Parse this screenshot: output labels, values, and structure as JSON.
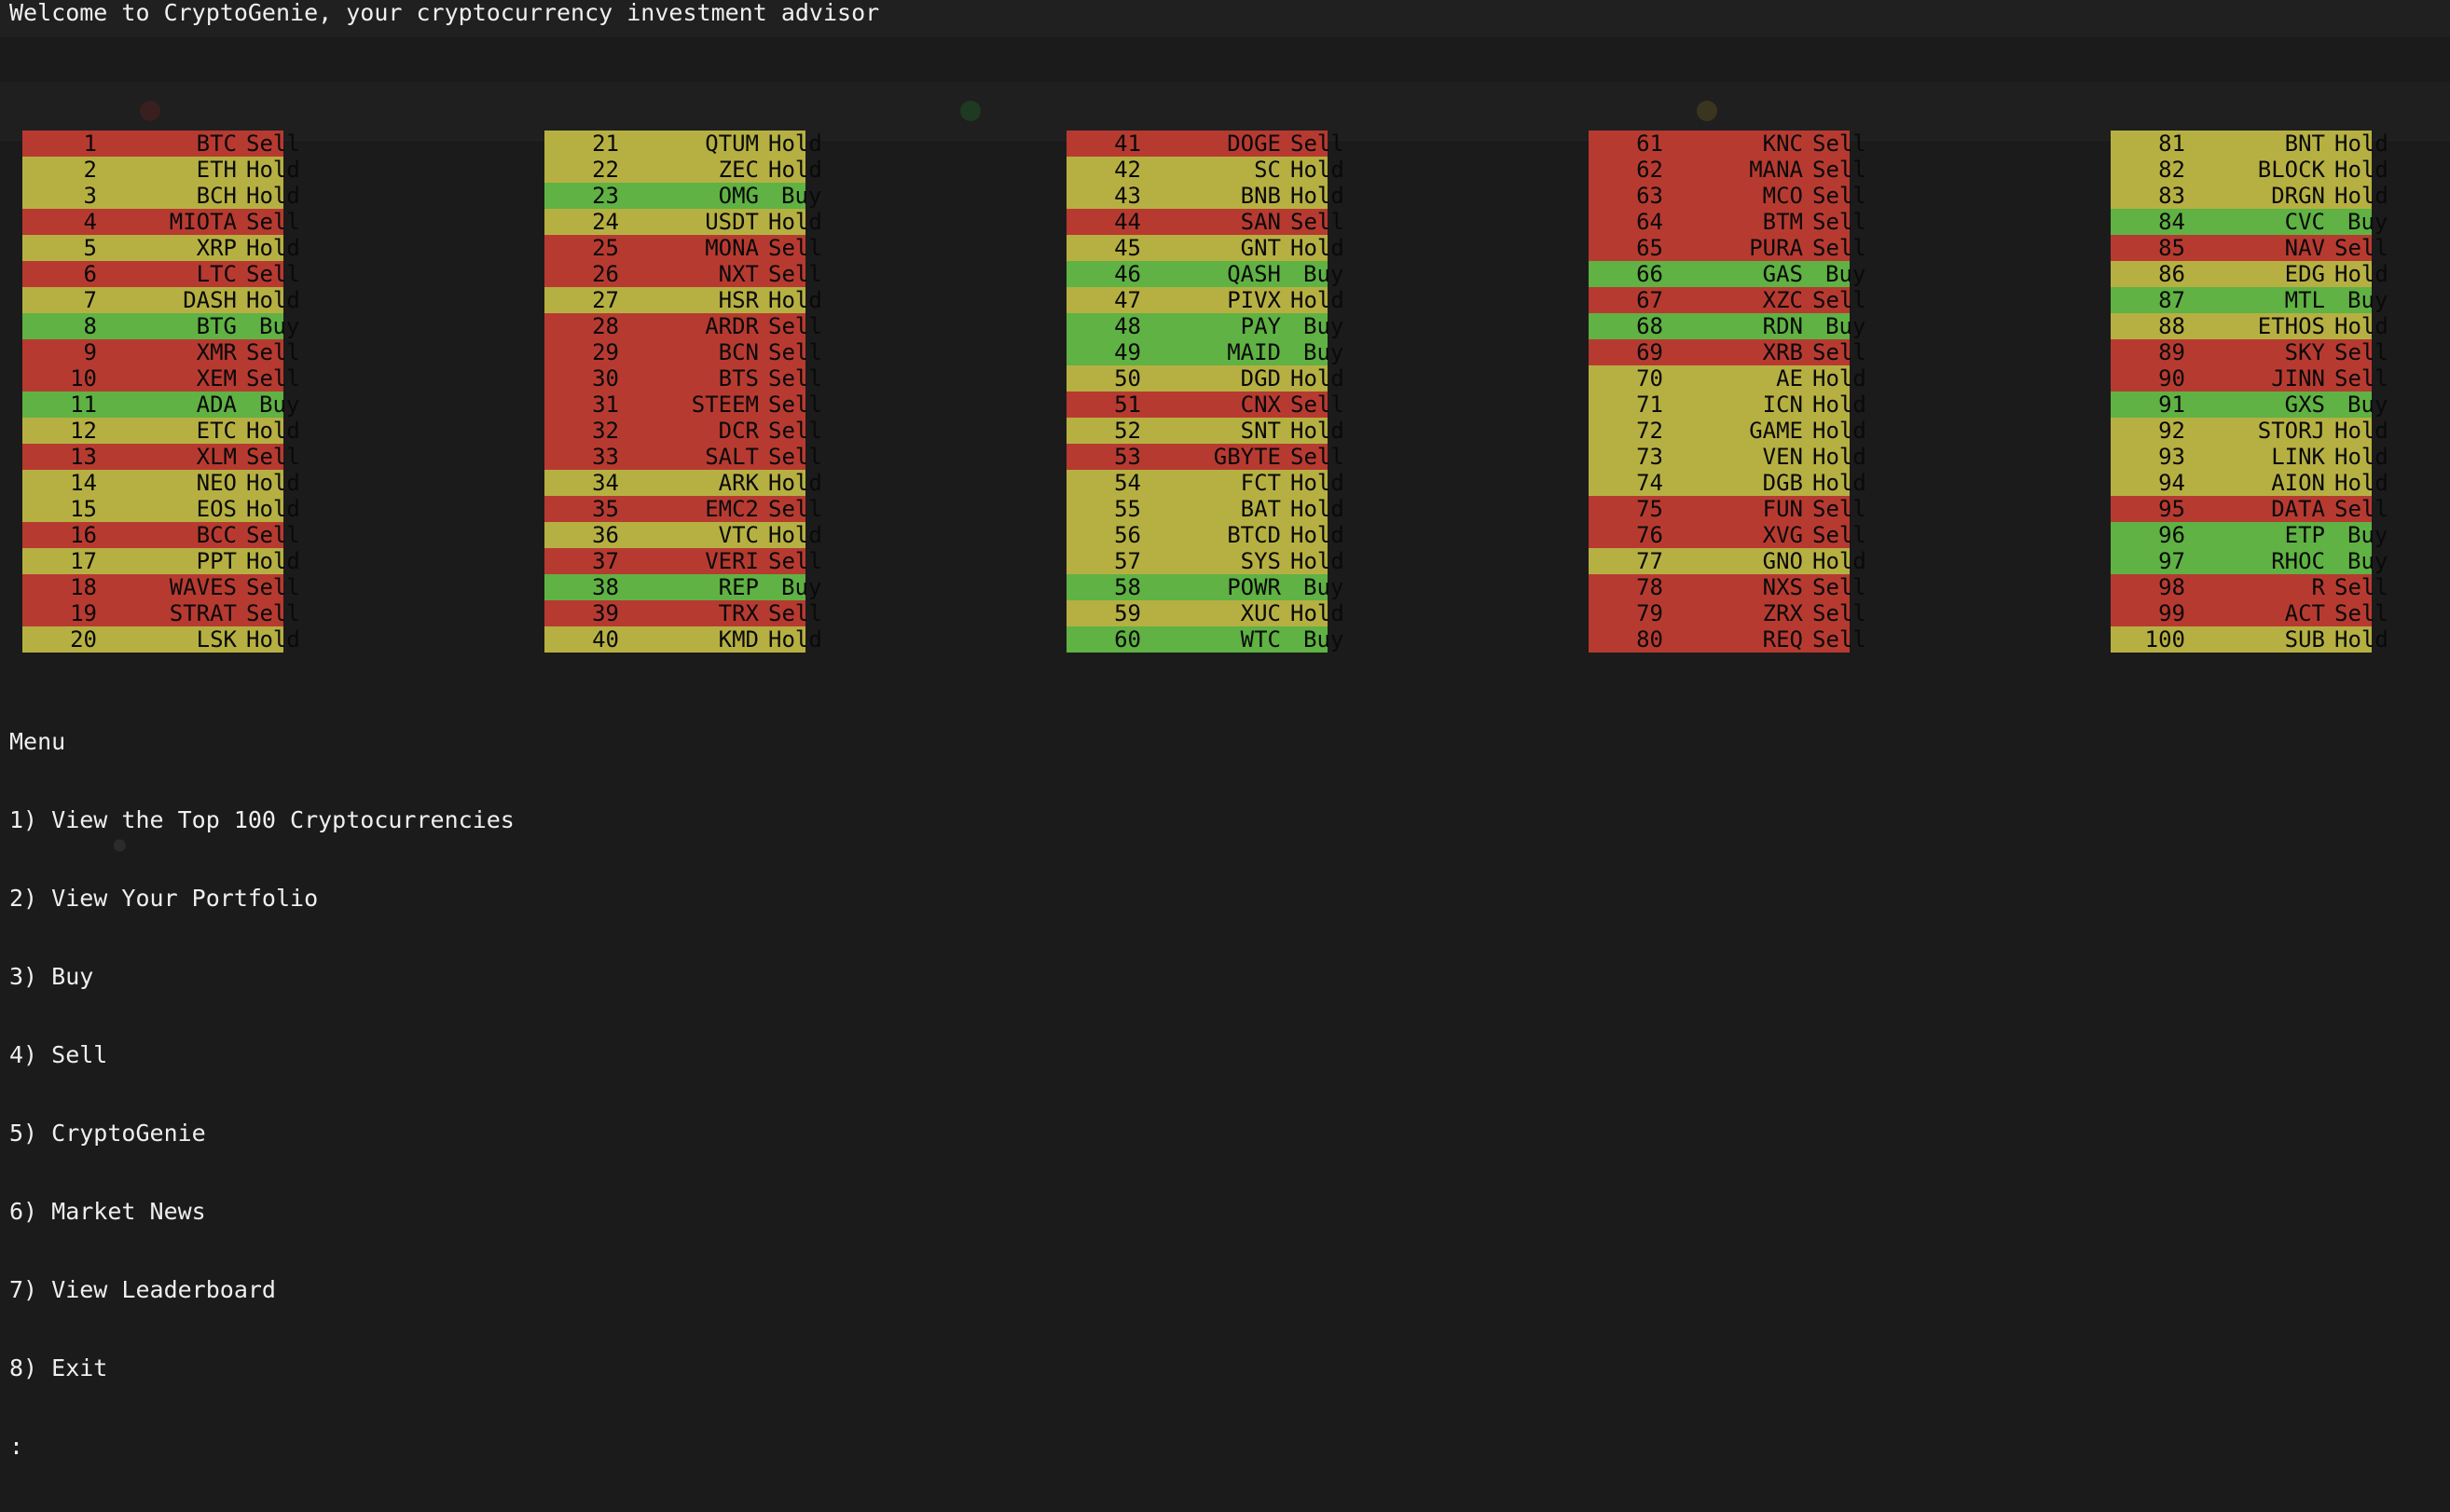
{
  "welcome": "Welcome to CryptoGenie, your cryptocurrency investment advisor",
  "colors": {
    "sell": "#b73a31",
    "hold": "#b6b043",
    "buy": "#5fb243"
  },
  "columns": [
    [
      [
        "1",
        "BTC",
        "Sell"
      ],
      [
        "2",
        "ETH",
        "Hold"
      ],
      [
        "3",
        "BCH",
        "Hold"
      ],
      [
        "4",
        "MIOTA",
        "Sell"
      ],
      [
        "5",
        "XRP",
        "Hold"
      ],
      [
        "6",
        "LTC",
        "Sell"
      ],
      [
        "7",
        "DASH",
        "Hold"
      ],
      [
        "8",
        "BTG",
        "Buy"
      ],
      [
        "9",
        "XMR",
        "Sell"
      ],
      [
        "10",
        "XEM",
        "Sell"
      ],
      [
        "11",
        "ADA",
        "Buy"
      ],
      [
        "12",
        "ETC",
        "Hold"
      ],
      [
        "13",
        "XLM",
        "Sell"
      ],
      [
        "14",
        "NEO",
        "Hold"
      ],
      [
        "15",
        "EOS",
        "Hold"
      ],
      [
        "16",
        "BCC",
        "Sell"
      ],
      [
        "17",
        "PPT",
        "Hold"
      ],
      [
        "18",
        "WAVES",
        "Sell"
      ],
      [
        "19",
        "STRAT",
        "Sell"
      ],
      [
        "20",
        "LSK",
        "Hold"
      ]
    ],
    [
      [
        "21",
        "QTUM",
        "Hold"
      ],
      [
        "22",
        "ZEC",
        "Hold"
      ],
      [
        "23",
        "OMG",
        "Buy"
      ],
      [
        "24",
        "USDT",
        "Hold"
      ],
      [
        "25",
        "MONA",
        "Sell"
      ],
      [
        "26",
        "NXT",
        "Sell"
      ],
      [
        "27",
        "HSR",
        "Hold"
      ],
      [
        "28",
        "ARDR",
        "Sell"
      ],
      [
        "29",
        "BCN",
        "Sell"
      ],
      [
        "30",
        "BTS",
        "Sell"
      ],
      [
        "31",
        "STEEM",
        "Sell"
      ],
      [
        "32",
        "DCR",
        "Sell"
      ],
      [
        "33",
        "SALT",
        "Sell"
      ],
      [
        "34",
        "ARK",
        "Hold"
      ],
      [
        "35",
        "EMC2",
        "Sell"
      ],
      [
        "36",
        "VTC",
        "Hold"
      ],
      [
        "37",
        "VERI",
        "Sell"
      ],
      [
        "38",
        "REP",
        "Buy"
      ],
      [
        "39",
        "TRX",
        "Sell"
      ],
      [
        "40",
        "KMD",
        "Hold"
      ]
    ],
    [
      [
        "41",
        "DOGE",
        "Sell"
      ],
      [
        "42",
        "SC",
        "Hold"
      ],
      [
        "43",
        "BNB",
        "Hold"
      ],
      [
        "44",
        "SAN",
        "Sell"
      ],
      [
        "45",
        "GNT",
        "Hold"
      ],
      [
        "46",
        "QASH",
        "Buy"
      ],
      [
        "47",
        "PIVX",
        "Hold"
      ],
      [
        "48",
        "PAY",
        "Buy"
      ],
      [
        "49",
        "MAID",
        "Buy"
      ],
      [
        "50",
        "DGD",
        "Hold"
      ],
      [
        "51",
        "CNX",
        "Sell"
      ],
      [
        "52",
        "SNT",
        "Hold"
      ],
      [
        "53",
        "GBYTE",
        "Sell"
      ],
      [
        "54",
        "FCT",
        "Hold"
      ],
      [
        "55",
        "BAT",
        "Hold"
      ],
      [
        "56",
        "BTCD",
        "Hold"
      ],
      [
        "57",
        "SYS",
        "Hold"
      ],
      [
        "58",
        "POWR",
        "Buy"
      ],
      [
        "59",
        "XUC",
        "Hold"
      ],
      [
        "60",
        "WTC",
        "Buy"
      ]
    ],
    [
      [
        "61",
        "KNC",
        "Sell"
      ],
      [
        "62",
        "MANA",
        "Sell"
      ],
      [
        "63",
        "MCO",
        "Sell"
      ],
      [
        "64",
        "BTM",
        "Sell"
      ],
      [
        "65",
        "PURA",
        "Sell"
      ],
      [
        "66",
        "GAS",
        "Buy"
      ],
      [
        "67",
        "XZC",
        "Sell"
      ],
      [
        "68",
        "RDN",
        "Buy"
      ],
      [
        "69",
        "XRB",
        "Sell"
      ],
      [
        "70",
        "AE",
        "Hold"
      ],
      [
        "71",
        "ICN",
        "Hold"
      ],
      [
        "72",
        "GAME",
        "Hold"
      ],
      [
        "73",
        "VEN",
        "Hold"
      ],
      [
        "74",
        "DGB",
        "Hold"
      ],
      [
        "75",
        "FUN",
        "Sell"
      ],
      [
        "76",
        "XVG",
        "Sell"
      ],
      [
        "77",
        "GNO",
        "Hold"
      ],
      [
        "78",
        "NXS",
        "Sell"
      ],
      [
        "79",
        "ZRX",
        "Sell"
      ],
      [
        "80",
        "REQ",
        "Sell"
      ]
    ],
    [
      [
        "81",
        "BNT",
        "Hold"
      ],
      [
        "82",
        "BLOCK",
        "Hold"
      ],
      [
        "83",
        "DRGN",
        "Hold"
      ],
      [
        "84",
        "CVC",
        "Buy"
      ],
      [
        "85",
        "NAV",
        "Sell"
      ],
      [
        "86",
        "EDG",
        "Hold"
      ],
      [
        "87",
        "MTL",
        "Buy"
      ],
      [
        "88",
        "ETHOS",
        "Hold"
      ],
      [
        "89",
        "SKY",
        "Sell"
      ],
      [
        "90",
        "JINN",
        "Sell"
      ],
      [
        "91",
        "GXS",
        "Buy"
      ],
      [
        "92",
        "STORJ",
        "Hold"
      ],
      [
        "93",
        "LINK",
        "Hold"
      ],
      [
        "94",
        "AION",
        "Hold"
      ],
      [
        "95",
        "DATA",
        "Sell"
      ],
      [
        "96",
        "ETP",
        "Buy"
      ],
      [
        "97",
        "RHOC",
        "Buy"
      ],
      [
        "98",
        "R",
        "Sell"
      ],
      [
        "99",
        "ACT",
        "Sell"
      ],
      [
        "100",
        "SUB",
        "Hold"
      ]
    ]
  ],
  "menu": {
    "title": "Menu",
    "items": [
      "1) View the Top 100 Cryptocurrencies",
      "2) View Your Portfolio",
      "3) Buy",
      "4) Sell",
      "5) CryptoGenie",
      "6) Market News",
      "7) View Leaderboard",
      "8) Exit"
    ],
    "prompt": ":"
  }
}
